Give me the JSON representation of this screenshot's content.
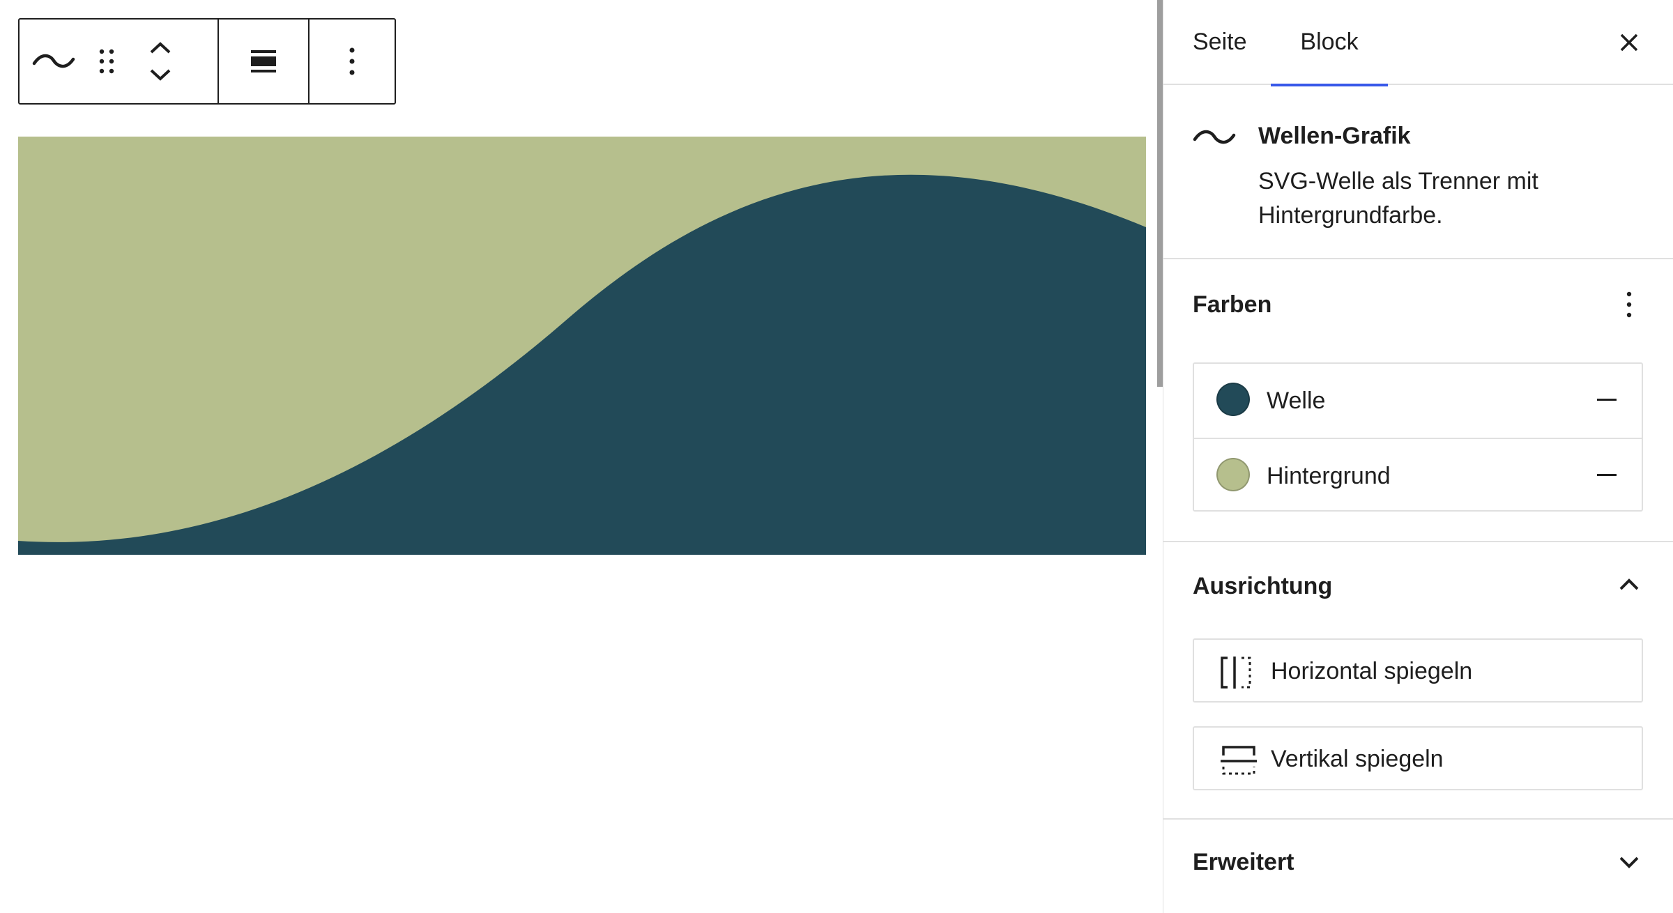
{
  "colors": {
    "wave": "#224a58",
    "background": "#b6bf8d",
    "accent": "#3858e9",
    "border": "#e0e0e0",
    "text": "#1e1e1e"
  },
  "toolbar": {
    "icons": [
      "wave-icon",
      "drag-handle-icon",
      "move-up-icon",
      "move-down-icon",
      "align-full-icon",
      "more-options-icon"
    ]
  },
  "sidebar": {
    "tabs": [
      {
        "label": "Seite",
        "active": false
      },
      {
        "label": "Block",
        "active": true
      }
    ],
    "close_icon": "close-icon",
    "block": {
      "title": "Wellen-Grafik",
      "description": "SVG-Welle als Trenner mit Hintergrundfarbe."
    },
    "colors_panel": {
      "title": "Farben",
      "items": [
        {
          "label": "Welle",
          "color": "#224a58"
        },
        {
          "label": "Hintergrund",
          "color": "#b6bf8d"
        }
      ]
    },
    "orientation_panel": {
      "title": "Ausrichtung",
      "expanded": true,
      "buttons": [
        {
          "label": "Horizontal spiegeln",
          "icon": "flip-horizontal-icon"
        },
        {
          "label": "Vertikal spiegeln",
          "icon": "flip-vertical-icon"
        }
      ]
    },
    "advanced_panel": {
      "title": "Erweitert",
      "expanded": false
    }
  }
}
